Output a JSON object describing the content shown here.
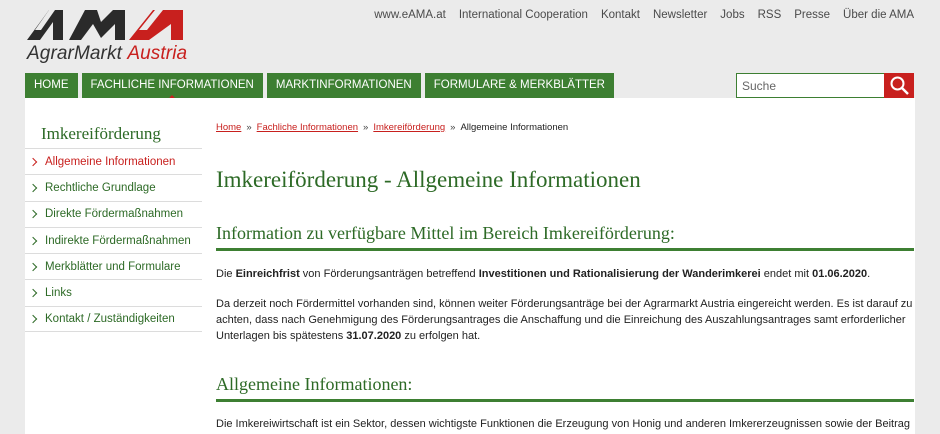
{
  "logo": {
    "mark": "AMA",
    "name_a": "AgrarMarkt",
    "name_b": "Austria"
  },
  "topnav": [
    "www.eAMA.at",
    "International Cooperation",
    "Kontakt",
    "Newsletter",
    "Jobs",
    "RSS",
    "Presse",
    "Über die AMA"
  ],
  "mainnav": [
    {
      "label": "HOME"
    },
    {
      "label": "FACHLICHE INFORMATIONEN",
      "active": true
    },
    {
      "label": "MARKTINFORMATIONEN"
    },
    {
      "label": "FORMULARE & MERKBLÄTTER"
    }
  ],
  "search": {
    "placeholder": "Suche"
  },
  "sidebar": {
    "title": "Imkereiförderung",
    "items": [
      {
        "label": "Allgemeine Informationen",
        "active": true
      },
      {
        "label": "Rechtliche Grundlage"
      },
      {
        "label": "Direkte Fördermaßnahmen"
      },
      {
        "label": "Indirekte Fördermaßnahmen"
      },
      {
        "label": "Merkblätter und Formulare"
      },
      {
        "label": "Links"
      },
      {
        "label": "Kontakt / Zuständigkeiten"
      }
    ]
  },
  "breadcrumb": {
    "items": [
      "Home",
      "Fachliche Informationen",
      "Imkereiförderung"
    ],
    "current": "Allgemeine Informationen",
    "separator": "»"
  },
  "main": {
    "title": "Imkereiförderung - Allgemeine Informationen",
    "section1": {
      "heading": "Information zu verfügbare Mittel im Bereich Imkereiförderung:",
      "p1": {
        "t1": "Die ",
        "b1": "Einreichfrist",
        "t2": " von Förderungsanträgen betreffend ",
        "b2": "Investitionen und Rationalisierung der Wanderimkerei",
        "t3": " endet mit ",
        "b3": "01.06.2020",
        "t4": "."
      },
      "p2": {
        "t1": "Da derzeit noch Fördermittel vorhanden sind, können weiter Förderungsanträge bei der Agrarmarkt Austria eingereicht werden. Es ist darauf zu achten, dass nach Genehmigung des Förderungsantrages die Anschaffung und die Einreichung des Auszahlungsantrages samt erforderlicher Unterlagen bis spätestens ",
        "b1": "31.07.2020",
        "t2": " zu erfolgen hat."
      }
    },
    "section2": {
      "heading": "Allgemeine Informationen:",
      "p1": "Die Imkereiwirtschaft ist ein Sektor, dessen wichtigste Funktionen die Erzeugung von Honig und anderen Imkererzeugnissen sowie der Beitrag zur"
    }
  },
  "colors": {
    "green": "#3d7f32",
    "dark_green": "#2d6a26",
    "red": "#c8201e"
  }
}
